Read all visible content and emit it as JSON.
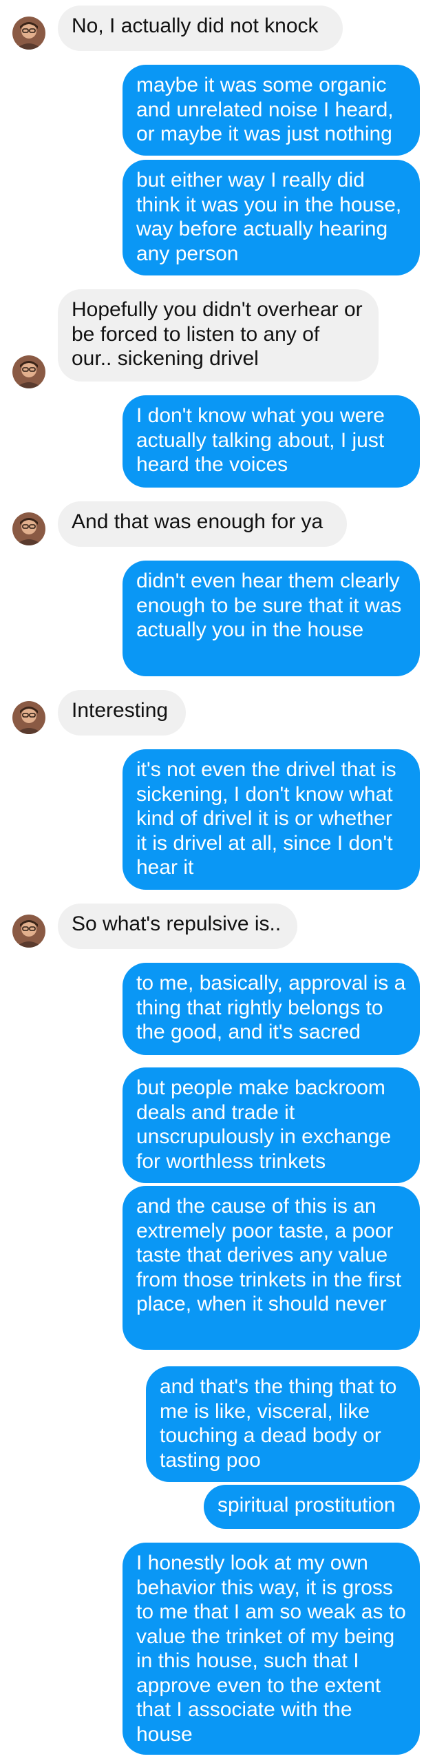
{
  "colors": {
    "incoming_bubble": "#f0f0f0",
    "outgoing_bubble": "#0a97f5",
    "incoming_text": "#111111",
    "outgoing_text": "#ffffff"
  },
  "messages": [
    {
      "sender": "them",
      "text": "No, I actually did not knock"
    },
    {
      "sender": "me",
      "text": "maybe it was some organic and unrelated noise I heard, or maybe it was just nothing"
    },
    {
      "sender": "me",
      "text": "but either way I really did think it was you in the house, way before actually hearing any person"
    },
    {
      "sender": "them",
      "text": "Hopefully you didn't overhear or be forced to listen to any of our.. sickening drivel"
    },
    {
      "sender": "me",
      "text": "I don't know what you were actually talking about, I just heard the voices"
    },
    {
      "sender": "them",
      "text": "And that was enough for ya"
    },
    {
      "sender": "me",
      "text": "didn't even hear them clearly enough to be sure that it was actually you in the house"
    },
    {
      "sender": "them",
      "text": "Interesting"
    },
    {
      "sender": "me",
      "text": "it's not even the drivel that is sickening, I don't know what kind of drivel it is or whether it is drivel at all, since I don't hear it"
    },
    {
      "sender": "them",
      "text": "So what's repulsive is.."
    },
    {
      "sender": "me",
      "text": "to me, basically, approval is a thing that rightly belongs to the good, and it's sacred"
    },
    {
      "sender": "me",
      "text": "but people make backroom deals and trade it unscrupulously in exchange for worthless trinkets"
    },
    {
      "sender": "me",
      "text": "and the cause of this is an extremely poor taste, a poor taste that derives any value from those trinkets in the first place, when it should never"
    },
    {
      "sender": "me",
      "text": "and that's the thing that to me is like, visceral, like touching a dead body or tasting poo"
    },
    {
      "sender": "me",
      "text": "spiritual prostitution"
    },
    {
      "sender": "me",
      "text": "I honestly look at my own behavior this way, it is gross to me that I am so weak as to value the trinket of my being in this house, such that I approve even to the extent that I associate with the house"
    }
  ]
}
